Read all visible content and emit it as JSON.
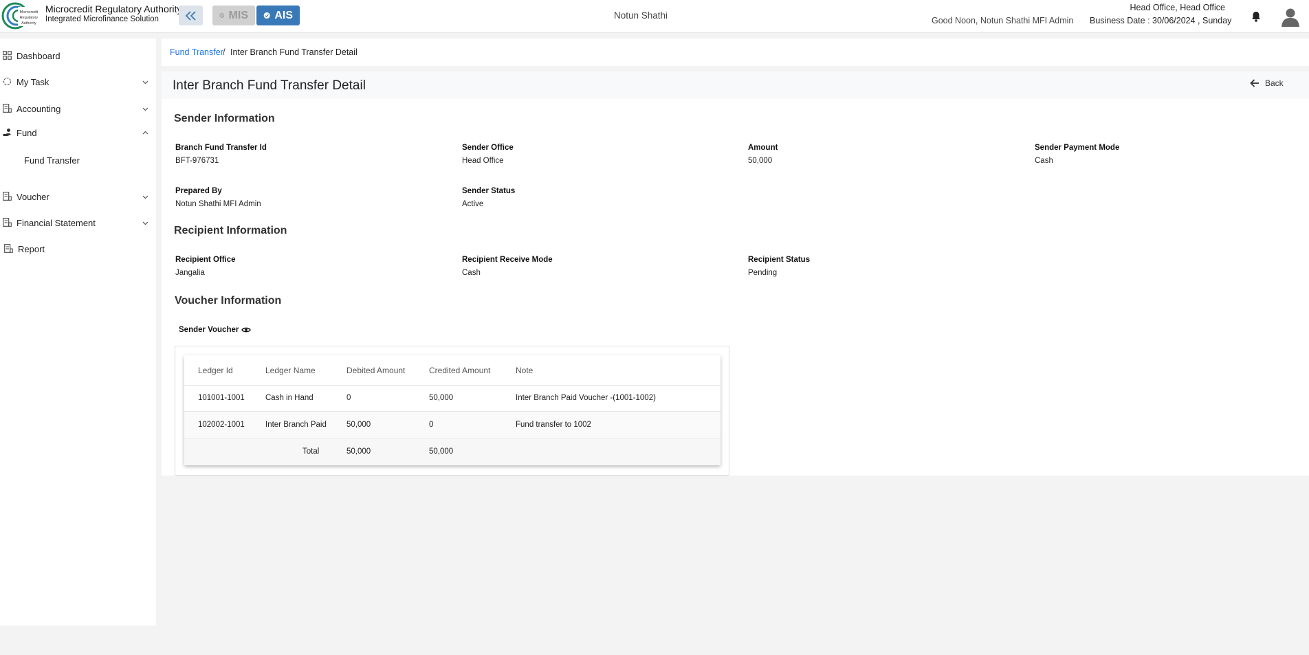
{
  "header": {
    "org_title": "Microcredit Regulatory Authority",
    "org_subtitle": "Integrated Microfinance Solution",
    "logo_text": "Microcredit Regulatory Authority",
    "mis_label": "MIS",
    "ais_label": "AIS",
    "center_name": "Notun Shathi",
    "greeting": "Good Noon, Notun Shathi MFI Admin",
    "office": "Head Office, Head Office",
    "business_date": "Business Date : 30/06/2024 , Sunday"
  },
  "sidebar": {
    "items": [
      {
        "label": "Dashboard",
        "icon": "grid-icon"
      },
      {
        "label": "My Task",
        "icon": "task-icon"
      },
      {
        "label": "Accounting",
        "icon": "ledger-icon"
      },
      {
        "label": "Fund",
        "icon": "hand-coin-icon"
      },
      {
        "label": "Voucher",
        "icon": "voucher-icon"
      },
      {
        "label": "Financial Statement",
        "icon": "statement-icon"
      },
      {
        "label": "Report",
        "icon": "report-icon"
      }
    ],
    "fund_sub": "Fund Transfer"
  },
  "breadcrumb": {
    "link": "Fund Transfer",
    "separator": "/",
    "current": "Inter Branch Fund Transfer Detail"
  },
  "page": {
    "title": "Inter Branch Fund Transfer Detail",
    "back_label": "Back"
  },
  "sender": {
    "section_title": "Sender Information",
    "fields": [
      {
        "label": "Branch Fund Transfer Id",
        "value": "BFT-976731"
      },
      {
        "label": "Sender Office",
        "value": "Head Office"
      },
      {
        "label": "Amount",
        "value": "50,000"
      },
      {
        "label": "Sender Payment Mode",
        "value": "Cash"
      },
      {
        "label": "Prepared By",
        "value": "Notun Shathi MFI Admin"
      },
      {
        "label": "Sender Status",
        "value": "Active"
      }
    ]
  },
  "recipient": {
    "section_title": "Recipient Information",
    "fields": [
      {
        "label": "Recipient Office",
        "value": "Jangalia"
      },
      {
        "label": "Recipient Receive Mode",
        "value": "Cash"
      },
      {
        "label": "Recipient Status",
        "value": "Pending"
      }
    ]
  },
  "voucher": {
    "section_title": "Voucher Information",
    "sender_voucher_label": "Sender Voucher",
    "columns": [
      "Ledger Id",
      "Ledger Name",
      "Debited Amount",
      "Credited Amount",
      "Note"
    ],
    "rows": [
      [
        "101001-1001",
        "Cash in Hand",
        "0",
        "50,000",
        "Inter Branch Paid Voucher -(1001-1002)"
      ],
      [
        "102002-1001",
        "Inter Branch Paid",
        "50,000",
        "0",
        "Fund transfer to 1002"
      ]
    ],
    "total": {
      "label": "Total",
      "debited": "50,000",
      "credited": "50,000"
    }
  },
  "colors": {
    "accent": "#3a79b8",
    "link": "#1a73e8",
    "disabled": "#d0d0d0"
  }
}
